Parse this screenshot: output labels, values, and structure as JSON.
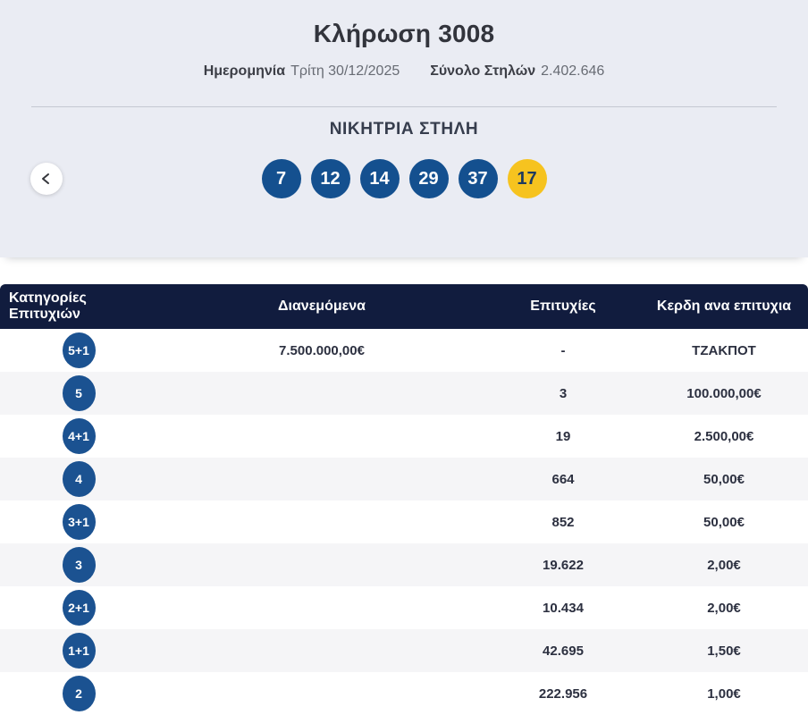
{
  "draw": {
    "title": "Κλήρωση 3008",
    "date_label": "Ημερομηνία",
    "date_value": "Τρίτη 30/12/2025",
    "columns_label": "Σύνολο Στηλών",
    "columns_value": "2.402.646"
  },
  "winning": {
    "heading": "ΝΙΚΗΤΡΙΑ ΣΤΗΛΗ",
    "numbers": [
      "7",
      "12",
      "14",
      "29",
      "37"
    ],
    "bonus": "17"
  },
  "table": {
    "headers": [
      "Κατηγορίες Επιτυχιών",
      "Διανεμόμενα",
      "Επιτυχίες",
      "Κερδη ανα επιτυχια"
    ],
    "rows": [
      {
        "category": "5+1",
        "distributed": "7.500.000,00€",
        "winners": "-",
        "prize": "ΤΖΑΚΠΟΤ"
      },
      {
        "category": "5",
        "distributed": "",
        "winners": "3",
        "prize": "100.000,00€"
      },
      {
        "category": "4+1",
        "distributed": "",
        "winners": "19",
        "prize": "2.500,00€"
      },
      {
        "category": "4",
        "distributed": "",
        "winners": "664",
        "prize": "50,00€"
      },
      {
        "category": "3+1",
        "distributed": "",
        "winners": "852",
        "prize": "50,00€"
      },
      {
        "category": "3",
        "distributed": "",
        "winners": "19.622",
        "prize": "2,00€"
      },
      {
        "category": "2+1",
        "distributed": "",
        "winners": "10.434",
        "prize": "2,00€"
      },
      {
        "category": "1+1",
        "distributed": "",
        "winners": "42.695",
        "prize": "1,50€"
      },
      {
        "category": "2",
        "distributed": "",
        "winners": "222.956",
        "prize": "1,00€"
      }
    ]
  },
  "colors": {
    "ball_blue": "#14508f",
    "ball_yellow": "#f6c31f",
    "header_navy": "#111c3e",
    "hero_bg": "#eaecf3",
    "badge_blue": "#1b5291"
  }
}
